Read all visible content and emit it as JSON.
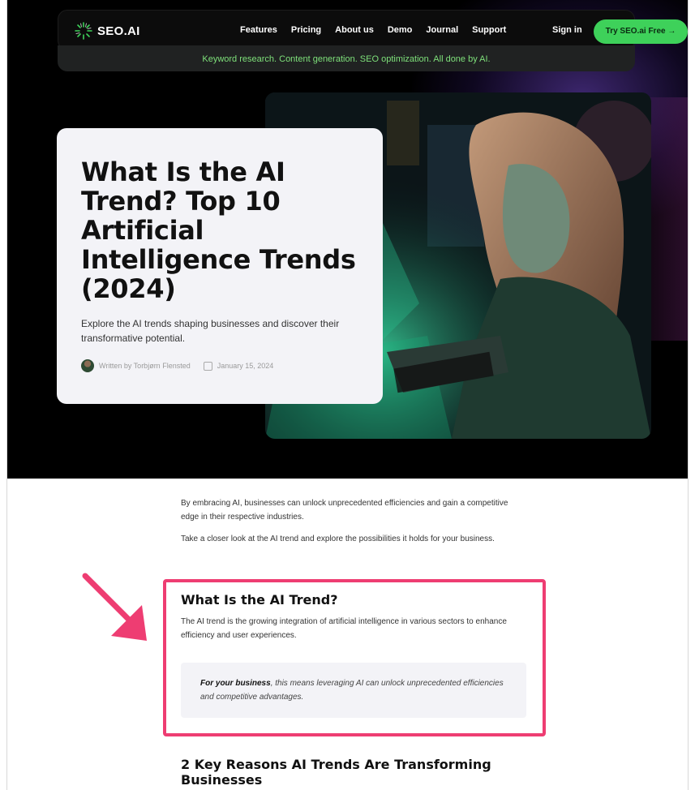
{
  "nav": {
    "logo": "SEO.AI",
    "links": [
      "Features",
      "Pricing",
      "About us",
      "Demo",
      "Journal",
      "Support"
    ],
    "sign_in": "Sign in",
    "cta": "Try SEO.ai Free →"
  },
  "tagline": "Keyword research. Content generation. SEO optimization. All done by AI.",
  "hero": {
    "title": "What Is the AI Trend? Top 10 Artificial Intelligence Trends (2024)",
    "subtitle": "Explore the AI trends shaping businesses and discover their transformative potential.",
    "author": "Written by Torbjørn Flensted",
    "date": "January 15, 2024"
  },
  "intro": [
    "By embracing AI, businesses can unlock unprecedented efficiencies and gain a competitive edge in their respective industries.",
    "Take a closer look at the AI trend and explore the possibilities it holds for your business."
  ],
  "section": {
    "heading": "What Is the AI Trend?",
    "text": "The AI trend is the growing integration of artificial intelligence in various sectors to enhance efficiency and user experiences.",
    "callout_bold": "For your business",
    "callout_rest": ", this means leveraging AI can unlock unprecedented efficiencies and competitive advantages."
  },
  "next_heading": "2 Key Reasons AI Trends Are Transforming Businesses",
  "colors": {
    "accent_green": "#3ed15a",
    "tagline_green": "#7ee07a",
    "highlight": "#ee3d72"
  },
  "icons": [
    "logo-burst-icon",
    "calendar-icon",
    "arrow-annotation-icon"
  ]
}
